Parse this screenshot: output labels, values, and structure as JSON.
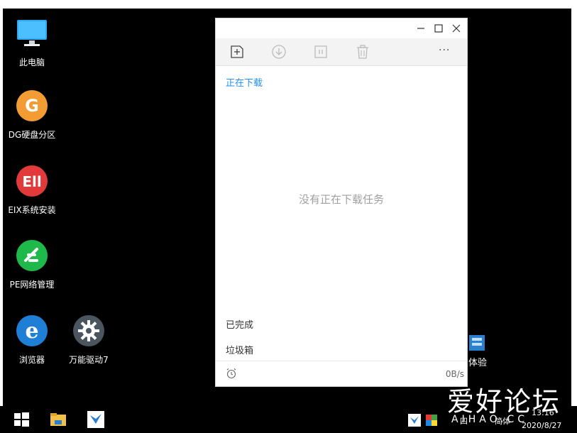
{
  "desktop": {
    "icons": [
      {
        "label": "此电脑"
      },
      {
        "label": "DG硬盘分区"
      },
      {
        "label": "EIX系统安装"
      },
      {
        "label": "PE网络管理"
      },
      {
        "label": "浏览器"
      },
      {
        "label": "万能驱动7"
      }
    ],
    "partial_icon_label": "体验"
  },
  "window": {
    "sections": {
      "downloading": "正在下载",
      "completed": "已完成",
      "trash": "垃圾箱"
    },
    "empty_message": "没有正在下载任务",
    "speed": "0B/s",
    "more_label": "···"
  },
  "taskbar": {
    "time": "13:16",
    "date": "2020/8/27",
    "lang": "简体",
    "tray_text": "四"
  },
  "watermark": {
    "text": "爱好论坛",
    "sub": "AIHAO.CC"
  },
  "colors": {
    "accent": "#1e90ff",
    "desktop_bg": "#000000",
    "toolbar_bg": "#f3f3f3"
  }
}
